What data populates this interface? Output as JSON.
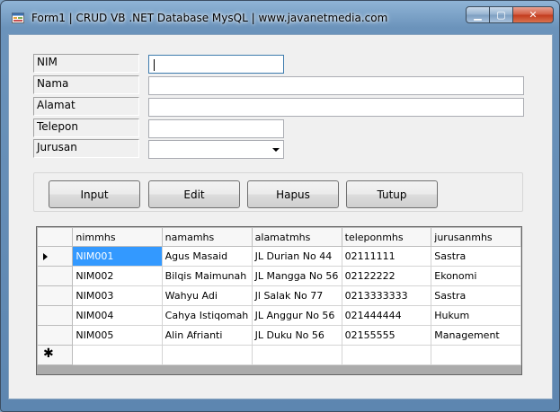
{
  "window": {
    "title": "Form1 | CRUD VB .NET Database MysQL | www.javanetmedia.com",
    "minimize_glyph": "▁",
    "maximize_glyph": "▢",
    "close_glyph": "✕"
  },
  "form": {
    "nim_label": "NIM",
    "nama_label": "Nama",
    "alamat_label": "Alamat",
    "telepon_label": "Telepon",
    "jurusan_label": "Jurusan",
    "nim_value": "",
    "nama_value": "",
    "alamat_value": "",
    "telepon_value": "",
    "jurusan_value": ""
  },
  "buttons": {
    "input": "Input",
    "edit": "Edit",
    "hapus": "Hapus",
    "tutup": "Tutup"
  },
  "grid": {
    "columns": [
      "nimmhs",
      "namamhs",
      "alamatmhs",
      "teleponmhs",
      "jurusanmhs"
    ],
    "rows": [
      [
        "NIM001",
        "Agus Masaid",
        "JL Durian No 44",
        "02111111",
        "Sastra"
      ],
      [
        "NIM002",
        "Bilqis Maimunah",
        "JL Mangga No 56",
        "02122222",
        "Ekonomi"
      ],
      [
        "NIM003",
        "Wahyu Adi",
        "Jl Salak No 77",
        "0213333333",
        "Sastra"
      ],
      [
        "NIM004",
        "Cahya Istiqomah",
        "JL Anggur No 56",
        "021444444",
        "Hukum"
      ],
      [
        "NIM005",
        "Alin Afrianti",
        "JL Duku No 56",
        "02155555",
        "Management"
      ]
    ],
    "new_row_marker": "✱"
  }
}
